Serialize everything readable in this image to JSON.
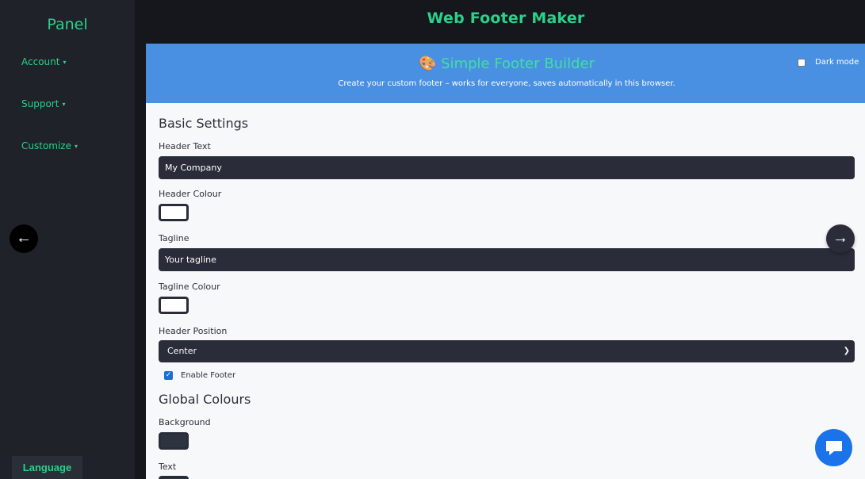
{
  "sidebar": {
    "brand": "Panel",
    "items": [
      {
        "label": "Account",
        "caret": "▾"
      },
      {
        "label": "Support",
        "caret": "▾"
      },
      {
        "label": "Customize",
        "caret": "▾"
      }
    ],
    "language_label": "Language"
  },
  "topbar": {
    "title": "Web Footer Maker"
  },
  "hero": {
    "title": "🎨 Simple Footer Builder",
    "subtitle": "Create your custom footer – works for everyone, saves automatically in this browser.",
    "dark_mode_label": "Dark mode",
    "dark_mode_checked": false
  },
  "basic": {
    "section_title": "Basic Settings",
    "header_text_label": "Header Text",
    "header_text_value": "My Company",
    "header_colour_label": "Header Colour",
    "tagline_label": "Tagline",
    "tagline_value": "Your tagline",
    "tagline_colour_label": "Tagline Colour",
    "header_position_label": "Header Position",
    "header_position_value": "Center",
    "enable_footer_label": "Enable Footer",
    "enable_footer_checked": true
  },
  "global": {
    "section_title": "Global Colours",
    "background_label": "Background",
    "text_label": "Text"
  },
  "colors": {
    "accent": "#2bd18a",
    "hero_bg": "#4a90e2",
    "input_bg": "#2a2d39",
    "background_swatch": "#2c3440",
    "header_swatch": "#ffffff",
    "tagline_swatch": "#ffffff"
  },
  "icons": {
    "prev": "arrow-left-icon",
    "next": "arrow-right-icon",
    "chat": "chat-icon",
    "select_chevron": "chevron-down-icon"
  }
}
